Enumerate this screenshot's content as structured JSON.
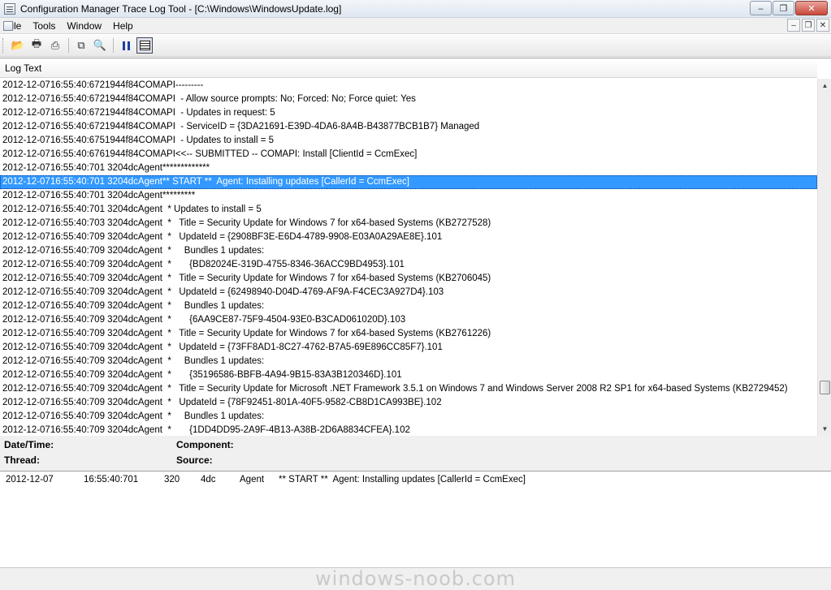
{
  "window": {
    "title": "Configuration Manager Trace Log Tool - [C:\\Windows\\WindowsUpdate.log]",
    "minimize_glyph": "‒",
    "restore_glyph": "❐",
    "close_glyph": "✕"
  },
  "menu": {
    "items": [
      "File",
      "Tools",
      "Window",
      "Help"
    ],
    "mdi_minimize": "‒",
    "mdi_restore": "❐",
    "mdi_close": "✕"
  },
  "toolbar": {
    "open_glyph": "📂",
    "print_preview_glyph": "🖶",
    "print_glyph": "⎙",
    "copy_glyph": "⧉",
    "find_glyph": "🔍"
  },
  "log": {
    "column_header": "Log Text",
    "rows": [
      "2012-12-0716:55:40:6721944f84COMAPI---------",
      "2012-12-0716:55:40:6721944f84COMAPI  - Allow source prompts: No; Forced: No; Force quiet: Yes",
      "2012-12-0716:55:40:6721944f84COMAPI  - Updates in request: 5",
      "2012-12-0716:55:40:6721944f84COMAPI  - ServiceID = {3DA21691-E39D-4DA6-8A4B-B43877BCB1B7} Managed",
      "2012-12-0716:55:40:6751944f84COMAPI  - Updates to install = 5",
      "2012-12-0716:55:40:6761944f84COMAPI<<-- SUBMITTED -- COMAPI: Install [ClientId = CcmExec]",
      "2012-12-0716:55:40:701 3204dcAgent*************",
      "2012-12-0716:55:40:701 3204dcAgent** START **  Agent: Installing updates [CallerId = CcmExec]",
      "2012-12-0716:55:40:701 3204dcAgent*********",
      "2012-12-0716:55:40:701 3204dcAgent  * Updates to install = 5",
      "2012-12-0716:55:40:703 3204dcAgent  *   Title = Security Update for Windows 7 for x64-based Systems (KB2727528)",
      "2012-12-0716:55:40:709 3204dcAgent  *   UpdateId = {2908BF3E-E6D4-4789-9908-E03A0A29AE8E}.101",
      "2012-12-0716:55:40:709 3204dcAgent  *     Bundles 1 updates:",
      "2012-12-0716:55:40:709 3204dcAgent  *       {BD82024E-319D-4755-8346-36ACC9BD4953}.101",
      "2012-12-0716:55:40:709 3204dcAgent  *   Title = Security Update for Windows 7 for x64-based Systems (KB2706045)",
      "2012-12-0716:55:40:709 3204dcAgent  *   UpdateId = {62498940-D04D-4769-AF9A-F4CEC3A927D4}.103",
      "2012-12-0716:55:40:709 3204dcAgent  *     Bundles 1 updates:",
      "2012-12-0716:55:40:709 3204dcAgent  *       {6AA9CE87-75F9-4504-93E0-B3CAD061020D}.103",
      "2012-12-0716:55:40:709 3204dcAgent  *   Title = Security Update for Windows 7 for x64-based Systems (KB2761226)",
      "2012-12-0716:55:40:709 3204dcAgent  *   UpdateId = {73FF8AD1-8C27-4762-B7A5-69E896CC85F7}.101",
      "2012-12-0716:55:40:709 3204dcAgent  *     Bundles 1 updates:",
      "2012-12-0716:55:40:709 3204dcAgent  *       {35196586-BBFB-4A94-9B15-83A3B120346D}.101",
      "2012-12-0716:55:40:709 3204dcAgent  *   Title = Security Update for Microsoft .NET Framework 3.5.1 on Windows 7 and Windows Server 2008 R2 SP1 for x64-based Systems (KB2729452)",
      "2012-12-0716:55:40:709 3204dcAgent  *   UpdateId = {78F92451-801A-40F5-9582-CB8D1CA993BE}.102",
      "2012-12-0716:55:40:709 3204dcAgent  *     Bundles 1 updates:",
      "2012-12-0716:55:40:709 3204dcAgent  *       {1DD4DD95-2A9F-4B13-A38B-2D6A8834CFEA}.102"
    ],
    "selected_index": 7
  },
  "details": {
    "datetime_label": "Date/Time:",
    "component_label": "Component:",
    "thread_label": "Thread:",
    "source_label": "Source:",
    "date": "2012-12-07",
    "time": "16:55:40:701",
    "thread": "320",
    "thread_hex": "4dc",
    "component": "Agent",
    "message": "** START **  Agent: Installing updates [CallerId = CcmExec]"
  },
  "watermark": "windows-noob.com",
  "colors": {
    "selection": "#3399ff",
    "pause_icon": "#1e3fa3"
  }
}
